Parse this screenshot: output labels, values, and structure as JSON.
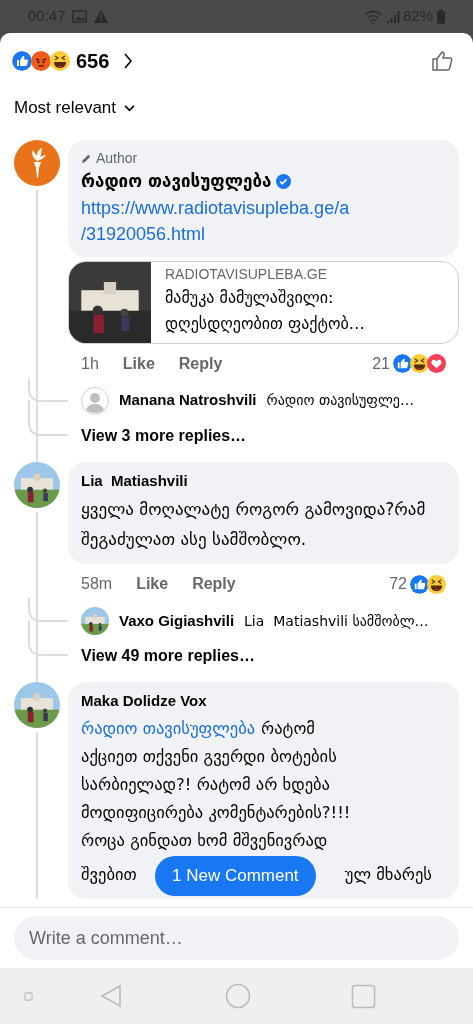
{
  "status_bar": {
    "time": "00:47",
    "battery": "82%"
  },
  "header": {
    "reactions": [
      {
        "kind": "like"
      },
      {
        "kind": "angry"
      },
      {
        "kind": "haha"
      }
    ],
    "count": "656"
  },
  "sort": {
    "label": "Most relevant"
  },
  "comments": [
    {
      "avatar": {
        "kind": "logo"
      },
      "badge": "Author",
      "name": "რადიო თავისუფლება",
      "verified": true,
      "link": [
        "https://www.radiotavisupleba.ge/a",
        "/31920056.html"
      ],
      "preview": {
        "domain": "RADIOTAVISUPLEBA.GE",
        "title": "მამუკა მამულაშვილი: დღესდღეობით ფაქტობ…"
      },
      "time": "1h",
      "like": "Like",
      "reply": "Reply",
      "reaction_count": "21",
      "reactions": [
        {
          "kind": "like"
        },
        {
          "kind": "haha"
        },
        {
          "kind": "love"
        }
      ],
      "replies": [
        {
          "avatar": {
            "kind": "silhouette"
          },
          "name": "Manana Natroshvili",
          "text": "რადიო თავისუფლე…"
        }
      ],
      "more": "View 3 more replies…"
    },
    {
      "avatar": {
        "kind": "picture"
      },
      "name": "Lia  Matiashvili",
      "text": "ყველა მოღალატე როგორ გამოვიდა?რამ შეგაძულათ ასე სამშობლო.",
      "time": "58m",
      "like": "Like",
      "reply": "Reply",
      "reaction_count": "72",
      "reactions": [
        {
          "kind": "like"
        },
        {
          "kind": "haha"
        }
      ],
      "replies": [
        {
          "avatar": {
            "kind": "picture"
          },
          "name": "Vaxo Gigiashvili",
          "text": "Lia  Matiashvili სამშობლ…"
        }
      ],
      "more": "View 49 more replies…"
    },
    {
      "avatar": {
        "kind": "picture"
      },
      "name": "Maka Dolidze Vox",
      "mention": "რადიო თავისუფლება",
      "lines": [
        "რატომ",
        "აქციეთ თქვენი გვერდი ბოტების",
        "სარბიელად?! რატომ არ ხდება",
        "მოდიფიცირება კომენტარების?!!!",
        "როცა გინდათ ხომ მშვენივრად"
      ],
      "split_line": [
        "შვებით",
        "ულ მხარეს"
      ]
    }
  ],
  "new_comment_button": "1 New Comment",
  "comment_field": {
    "placeholder": "Write a comment…"
  }
}
